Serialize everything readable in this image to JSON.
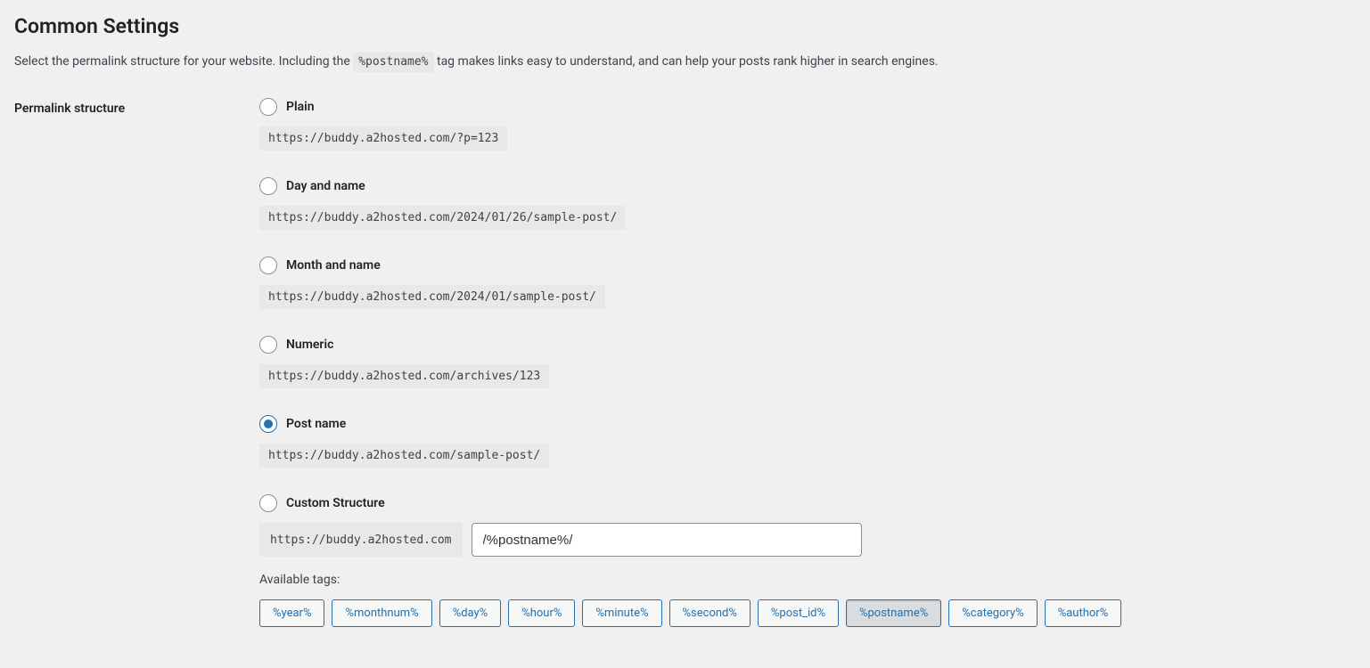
{
  "section": {
    "title": "Common Settings",
    "desc_pre": "Select the permalink structure for your website. Including the ",
    "desc_code": "%postname%",
    "desc_post": " tag makes links easy to understand, and can help your posts rank higher in search engines."
  },
  "form": {
    "row_label": "Permalink structure",
    "options": [
      {
        "id": "plain",
        "label": "Plain",
        "example": "https://buddy.a2hosted.com/?p=123",
        "checked": false
      },
      {
        "id": "dayname",
        "label": "Day and name",
        "example": "https://buddy.a2hosted.com/2024/01/26/sample-post/",
        "checked": false
      },
      {
        "id": "monthname",
        "label": "Month and name",
        "example": "https://buddy.a2hosted.com/2024/01/sample-post/",
        "checked": false
      },
      {
        "id": "numeric",
        "label": "Numeric",
        "example": "https://buddy.a2hosted.com/archives/123",
        "checked": false
      },
      {
        "id": "postname",
        "label": "Post name",
        "example": "https://buddy.a2hosted.com/sample-post/",
        "checked": true
      }
    ],
    "custom": {
      "label": "Custom Structure",
      "prefix": "https://buddy.a2hosted.com",
      "value": "/%postname%/",
      "checked": false
    },
    "available_label": "Available tags:",
    "tags": [
      {
        "text": "%year%",
        "active": false
      },
      {
        "text": "%monthnum%",
        "active": false
      },
      {
        "text": "%day%",
        "active": false
      },
      {
        "text": "%hour%",
        "active": false
      },
      {
        "text": "%minute%",
        "active": false
      },
      {
        "text": "%second%",
        "active": false
      },
      {
        "text": "%post_id%",
        "active": false
      },
      {
        "text": "%postname%",
        "active": true
      },
      {
        "text": "%category%",
        "active": false
      },
      {
        "text": "%author%",
        "active": false
      }
    ]
  }
}
